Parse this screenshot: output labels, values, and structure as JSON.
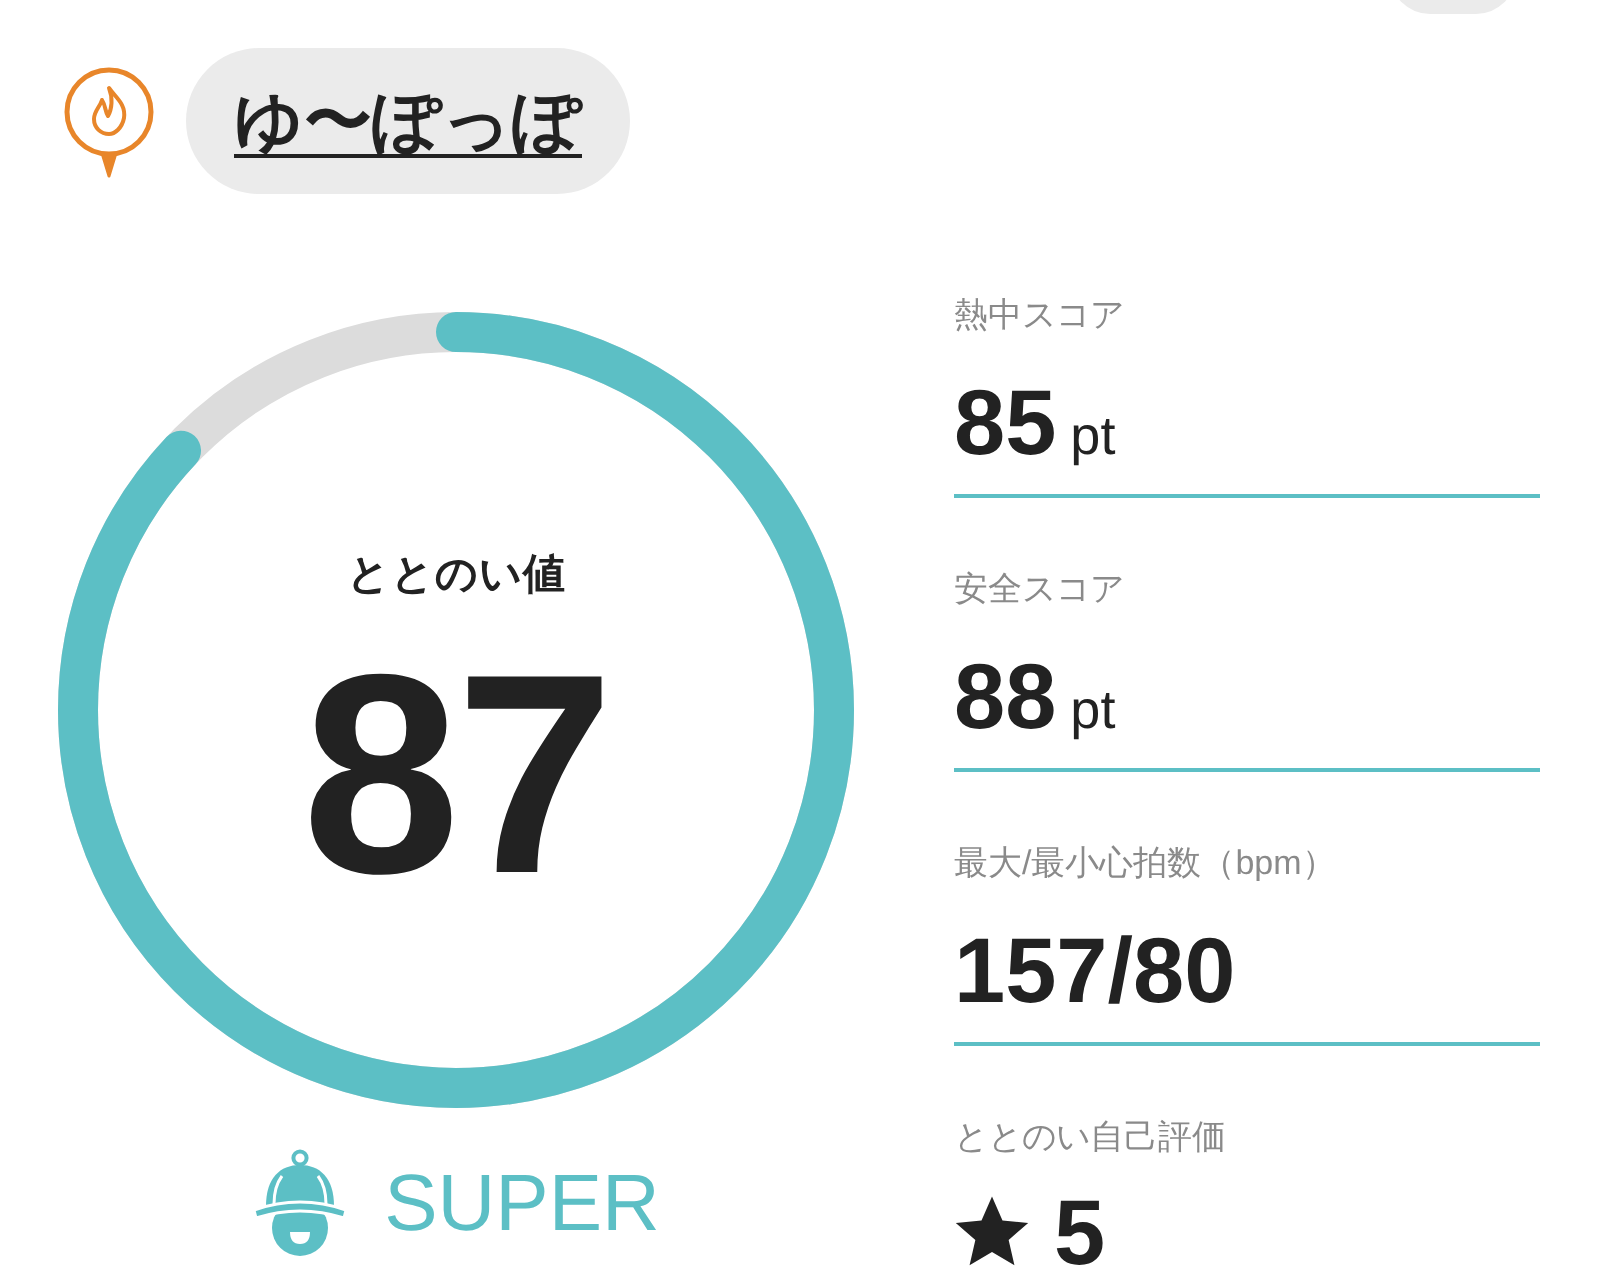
{
  "header": {
    "name": "ゆ〜ぽっぽ"
  },
  "gauge": {
    "label": "ととのい値",
    "value": "87",
    "level": 0.87,
    "rank": "SUPER"
  },
  "metrics": [
    {
      "kind": "number",
      "label": "熱中スコア",
      "value": "85",
      "unit": "pt"
    },
    {
      "kind": "number",
      "label": "安全スコア",
      "value": "88",
      "unit": "pt"
    },
    {
      "kind": "number",
      "label": "最大/最小心拍数（bpm）",
      "value": "157/80"
    },
    {
      "kind": "rating",
      "label": "ととのい自己評価",
      "value": "5"
    }
  ]
}
